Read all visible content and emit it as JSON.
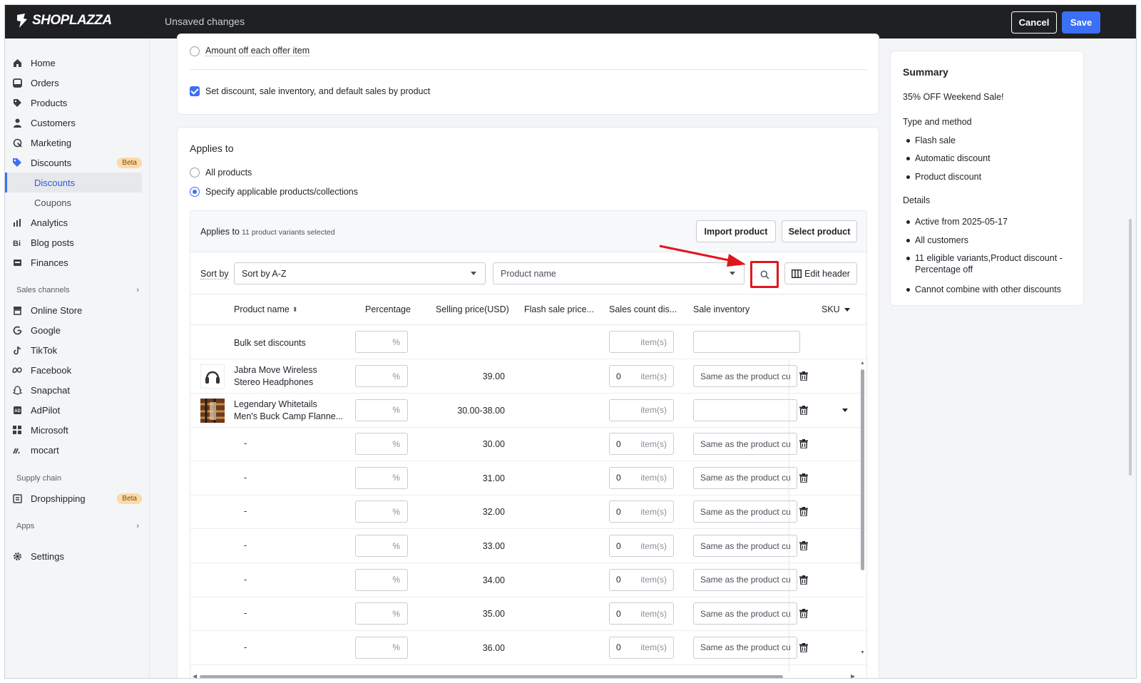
{
  "topbar": {
    "brand": "SHOPLAZZA",
    "status": "Unsaved changes",
    "cancel_label": "Cancel",
    "save_label": "Save"
  },
  "sidebar": {
    "items": [
      {
        "label": "Home",
        "icon": "home-icon"
      },
      {
        "label": "Orders",
        "icon": "orders-icon"
      },
      {
        "label": "Products",
        "icon": "tag-icon"
      },
      {
        "label": "Customers",
        "icon": "person-icon"
      },
      {
        "label": "Marketing",
        "icon": "marketing-icon"
      },
      {
        "label": "Discounts",
        "icon": "discount-icon",
        "badge": "Beta"
      },
      {
        "label": "Discounts",
        "sub": true,
        "active": true
      },
      {
        "label": "Coupons",
        "sub": true
      },
      {
        "label": "Analytics",
        "icon": "analytics-icon"
      },
      {
        "label": "Blog posts",
        "icon": "blog-icon"
      },
      {
        "label": "Finances",
        "icon": "finances-icon"
      }
    ],
    "sales_channels_label": "Sales channels",
    "channels": [
      {
        "label": "Online Store",
        "icon": "store-icon"
      },
      {
        "label": "Google",
        "icon": "google-icon"
      },
      {
        "label": "TikTok",
        "icon": "tiktok-icon"
      },
      {
        "label": "Facebook",
        "icon": "meta-icon"
      },
      {
        "label": "Snapchat",
        "icon": "snapchat-icon"
      },
      {
        "label": "AdPilot",
        "icon": "adpilot-icon"
      },
      {
        "label": "Microsoft",
        "icon": "microsoft-icon"
      },
      {
        "label": "mocart",
        "icon": "mocart-icon"
      }
    ],
    "supply_chain_label": "Supply chain",
    "dropshipping": {
      "label": "Dropshipping",
      "badge": "Beta"
    },
    "apps_label": "Apps",
    "settings_label": "Settings"
  },
  "options_card": {
    "amount_off_label": "Amount off each offer item",
    "set_by_product_label": "Set discount, sale inventory, and default sales by product",
    "set_by_product_checked": true
  },
  "applies": {
    "title": "Applies to",
    "all_products_label": "All products",
    "specify_label": "Specify applicable products/collections",
    "selected": "specify",
    "panel_title": "Applies to",
    "panel_count": "11 product variants selected",
    "import_label": "Import product",
    "select_label": "Select product",
    "sort_by_label": "Sort by",
    "sort_value": "Sort by A-Z",
    "search_field_value": "Product name",
    "edit_header_label": "Edit header"
  },
  "table": {
    "headers": {
      "product_name": "Product name",
      "percentage": "Percentage",
      "selling_price": "Selling price(USD)",
      "flash_price": "Flash sale price...",
      "sales_count": "Sales count dis...",
      "sale_inventory": "Sale inventory",
      "sku": "SKU"
    },
    "bulk_label": "Bulk set discounts",
    "pct_unit": "%",
    "items_unit": "item(s)",
    "rows": [
      {
        "name1": "Jabra Move Wireless",
        "name2": "Stereo Headphones",
        "price": "39.00",
        "count": "0",
        "inventory": "Same as the product cu",
        "thumb": "headphones"
      },
      {
        "name1": "Legendary Whitetails",
        "name2": "Men's Buck Camp Flanne...",
        "price": "30.00-38.00",
        "count": "",
        "inventory": "",
        "thumb": "flannel",
        "expand": true
      },
      {
        "name1": "-",
        "price": "30.00",
        "count": "0",
        "inventory": "Same as the product cu"
      },
      {
        "name1": "-",
        "price": "31.00",
        "count": "0",
        "inventory": "Same as the product cu"
      },
      {
        "name1": "-",
        "price": "32.00",
        "count": "0",
        "inventory": "Same as the product cu"
      },
      {
        "name1": "-",
        "price": "33.00",
        "count": "0",
        "inventory": "Same as the product cu"
      },
      {
        "name1": "-",
        "price": "34.00",
        "count": "0",
        "inventory": "Same as the product cu"
      },
      {
        "name1": "-",
        "price": "35.00",
        "count": "0",
        "inventory": "Same as the product cu"
      },
      {
        "name1": "-",
        "price": "36.00",
        "count": "0",
        "inventory": "Same as the product cu"
      }
    ]
  },
  "summary": {
    "title": "Summary",
    "name": "35% OFF Weekend Sale!",
    "type_title": "Type and method",
    "type_items": [
      "Flash sale",
      "Automatic discount",
      "Product discount"
    ],
    "details_title": "Details",
    "details_items": [
      "Active from 2025-05-17",
      "All customers",
      "11 eligible variants,Product discount -",
      "Percentage off",
      "Cannot combine with other discounts"
    ]
  },
  "colors": {
    "accent": "#3b6ff5",
    "highlight": "#e0161d",
    "topbar": "#1f2022"
  }
}
